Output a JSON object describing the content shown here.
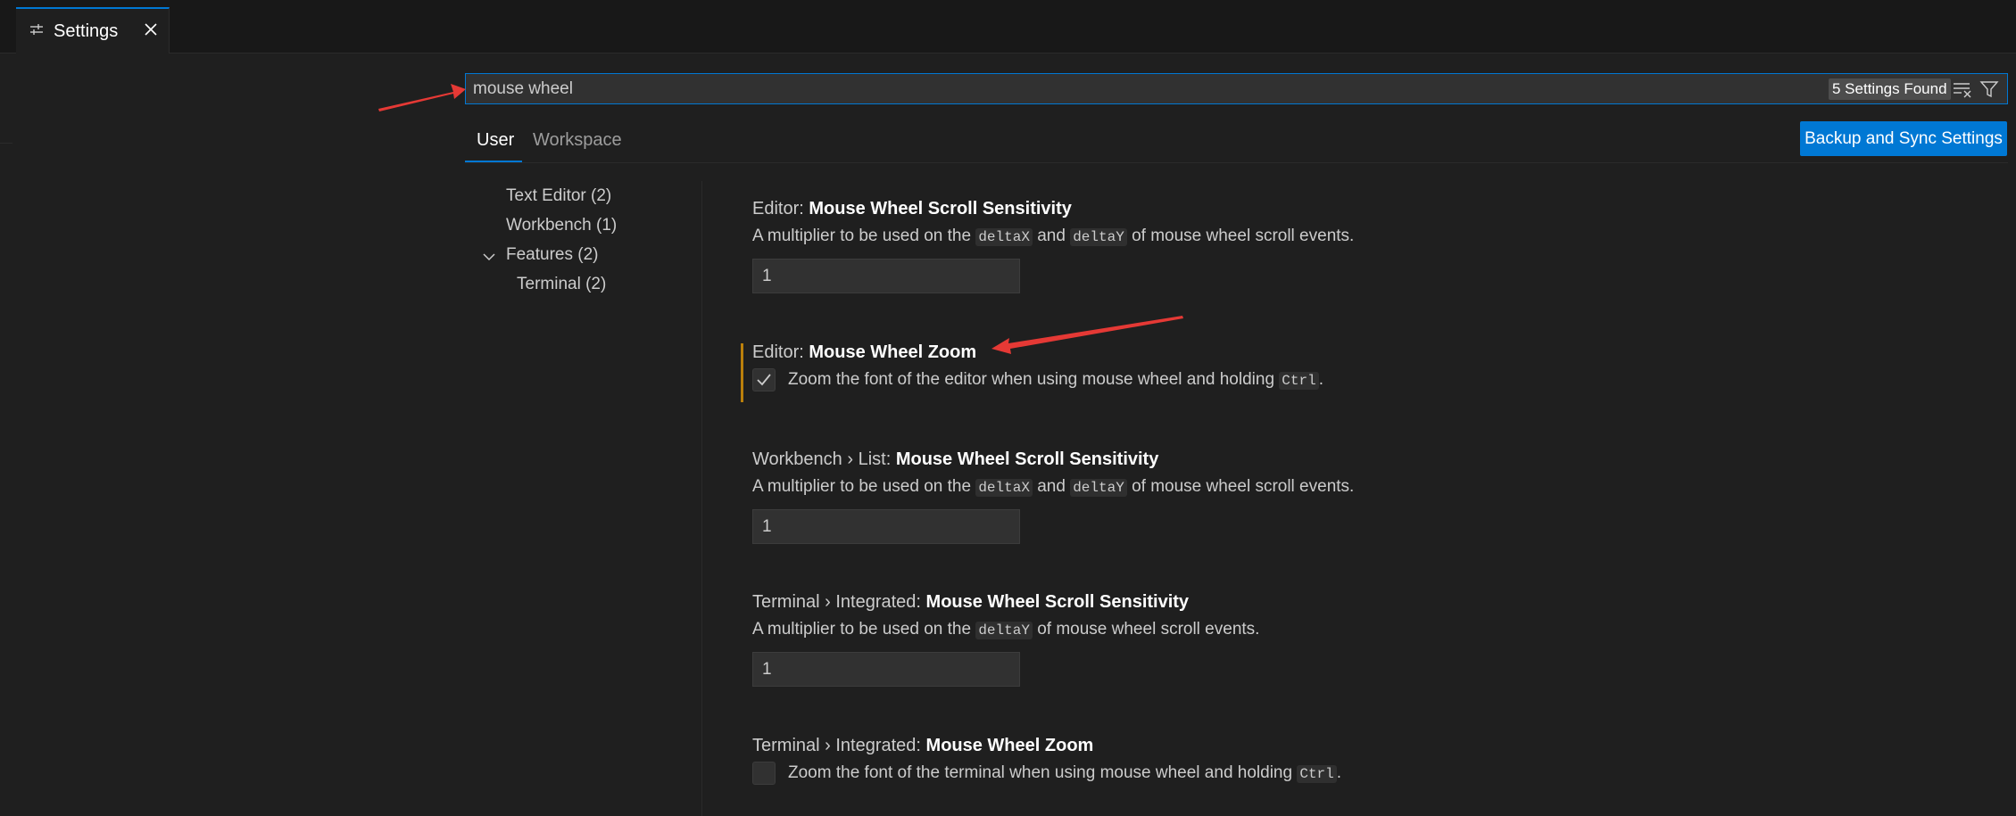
{
  "tab": {
    "label": "Settings",
    "icon": "settings-sliders-icon",
    "close_icon": "close-icon"
  },
  "search": {
    "value": "mouse wheel",
    "count_badge": "5 Settings Found"
  },
  "scope_tabs": {
    "user": "User",
    "workspace": "Workspace"
  },
  "sync_button": "Backup and Sync Settings",
  "toc": [
    {
      "label": "Text Editor (2)"
    },
    {
      "label": "Workbench (1)"
    },
    {
      "label": "Features (2)"
    },
    {
      "label": "Terminal (2)"
    }
  ],
  "settings": [
    {
      "category": "Editor: ",
      "name": "Mouse Wheel Scroll Sensitivity",
      "desc_pre": "A multiplier to be used on the ",
      "code1": "deltaX",
      "desc_mid": " and ",
      "code2": "deltaY",
      "desc_post": " of mouse wheel scroll events.",
      "value": "1"
    },
    {
      "category": "Editor: ",
      "name": "Mouse Wheel Zoom",
      "desc_pre": "Zoom the font of the editor when using mouse wheel and holding ",
      "code1": "Ctrl",
      "desc_post": ".",
      "checked": true
    },
    {
      "category": "Workbench › List: ",
      "name": "Mouse Wheel Scroll Sensitivity",
      "desc_pre": "A multiplier to be used on the ",
      "code1": "deltaX",
      "desc_mid": " and ",
      "code2": "deltaY",
      "desc_post": " of mouse wheel scroll events.",
      "value": "1"
    },
    {
      "category": "Terminal › Integrated: ",
      "name": "Mouse Wheel Scroll Sensitivity",
      "desc_pre": "A multiplier to be used on the ",
      "code1": "deltaY",
      "desc_post": " of mouse wheel scroll events.",
      "value": "1"
    },
    {
      "category": "Terminal › Integrated: ",
      "name": "Mouse Wheel Zoom",
      "desc_pre": "Zoom the font of the terminal when using mouse wheel and holding ",
      "code1": "Ctrl",
      "desc_post": ".",
      "checked": false
    }
  ],
  "colors": {
    "accent": "#0078d4",
    "annotation_arrow": "#e53935",
    "modified_indicator": "#bb800b"
  }
}
